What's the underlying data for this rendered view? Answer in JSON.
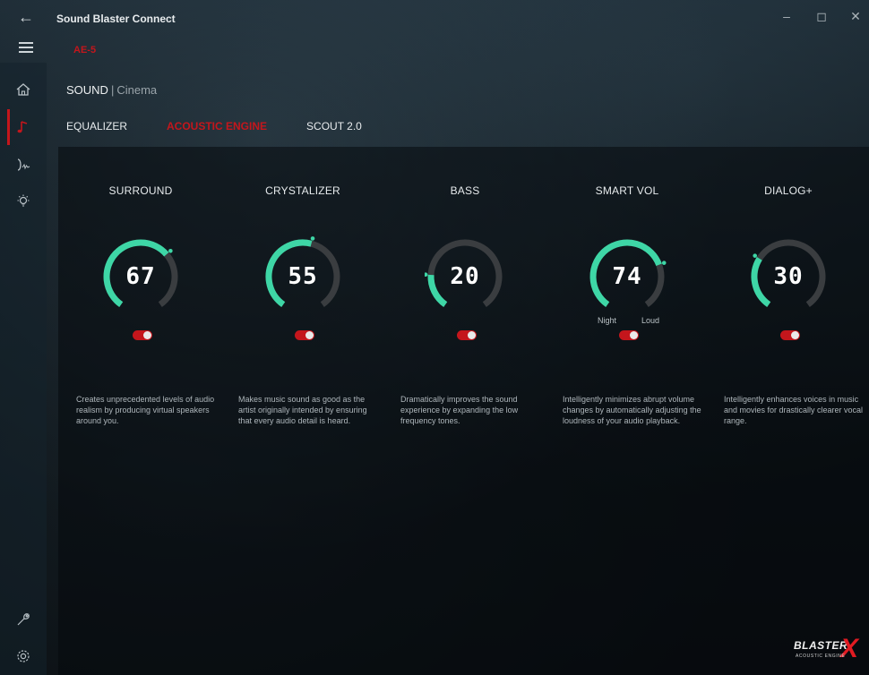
{
  "window": {
    "title": "Sound Blaster Connect",
    "controls": [
      "minimize",
      "maximize",
      "close"
    ]
  },
  "device": "AE-5",
  "breadcrumb": {
    "section": "SOUND",
    "separator": "|",
    "profile": "Cinema"
  },
  "tabs": [
    {
      "label": "EQUALIZER",
      "active": false
    },
    {
      "label": "ACOUSTIC ENGINE",
      "active": true
    },
    {
      "label": "SCOUT 2.0",
      "active": false
    }
  ],
  "sidebar": [
    {
      "icon": "home-icon"
    },
    {
      "icon": "music-note-icon",
      "active": true
    },
    {
      "icon": "microphone-icon"
    },
    {
      "icon": "lighting-icon"
    },
    {
      "icon": "wrench-icon"
    },
    {
      "icon": "settings-gear-icon"
    }
  ],
  "features": [
    {
      "title": "SURROUND",
      "value": "67",
      "enabled": true,
      "description": "Creates unprecedented levels of audio realism by producing virtual speakers around you."
    },
    {
      "title": "CRYSTALIZER",
      "value": "55",
      "enabled": true,
      "description": "Makes music sound as good as the artist originally intended by ensuring that every audio detail is heard."
    },
    {
      "title": "BASS",
      "value": "20",
      "enabled": true,
      "description": "Dramatically improves the sound experience by expanding the low frequency tones."
    },
    {
      "title": "SMART VOL",
      "value": "74",
      "enabled": true,
      "labels": {
        "min": "Night",
        "max": "Loud"
      },
      "description": "Intelligently minimizes abrupt volume changes by automatically adjusting the loudness of your audio playback."
    },
    {
      "title": "DIALOG+",
      "value": "30",
      "enabled": true,
      "description": "Intelligently enhances voices in music and movies for drastically clearer vocal range."
    }
  ],
  "logo": {
    "text": "BLASTER",
    "mark": "X",
    "sub": "ACOUSTIC ENGINE"
  },
  "colors": {
    "accent": "#c4161c",
    "dial_fill": "#3ed6a6",
    "dial_track": "#3a3d40"
  }
}
